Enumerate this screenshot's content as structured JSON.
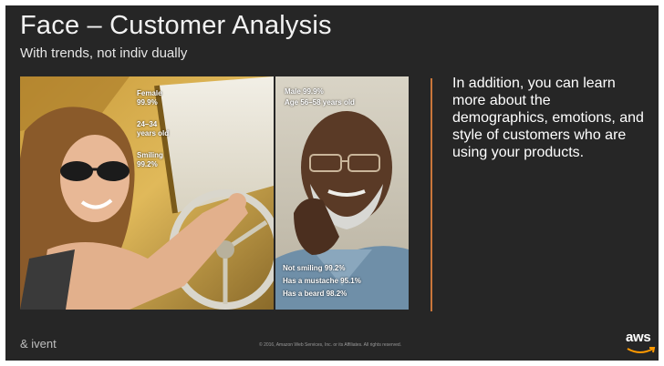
{
  "slide": {
    "title": "Face – Customer Analysis",
    "subtitle": "With trends, not indiv dually",
    "side_text": "In addition, you can learn more about the demographics, emotions, and style of customers who are using your products.",
    "footer_brand": "& ivent",
    "footer_copy": "© 2016, Amazon Web Services, Inc. or its Affiliates. All rights reserved.",
    "logo_text": "aws"
  },
  "woman_tags": {
    "gender": "Female",
    "gender_conf": "99.9%",
    "age": "24–34",
    "age_unit": "years old",
    "smile": "Smiling",
    "smile_conf": "99.2%"
  },
  "man_tags": {
    "gender": "Male 99.9%",
    "age": "Age 56–58 years old",
    "smile": "Not smiling 99.2%",
    "mustache": "Has a mustache 95.1%",
    "beard": "Has a beard 98.2%"
  },
  "colors": {
    "background": "#262626",
    "accent_divider": "#c9763a",
    "text": "#ffffff"
  }
}
